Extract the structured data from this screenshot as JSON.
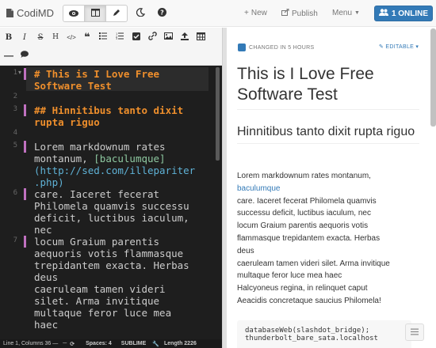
{
  "navbar": {
    "brand": "CodiMD",
    "new_label": "New",
    "publish_label": "Publish",
    "menu_label": "Menu",
    "online_label": "1 ONLINE"
  },
  "editor": {
    "line_numbers": [
      "1",
      "2",
      "3",
      "4",
      "5",
      "6",
      "7"
    ],
    "lines": {
      "l1a": "# This is I Love Free",
      "l1b": "Software Test",
      "l3a": "## Hinnitibus tanto dixit",
      "l3b": "rupta riguo",
      "l5a": "Lorem markdownum rates",
      "l5b_pre": "montanum, ",
      "l5b_link": "[baculumque]",
      "l5c": "(http://sed.com/illepariter",
      "l5d": ".php)",
      "l6a": "care. Iaceret fecerat",
      "l6b": "Philomela quamvis successu",
      "l6c": "deficit, luctibus iaculum,",
      "l6d": "nec",
      "l7a": "locum Graium parentis",
      "l7b": "aequoris votis flammasque",
      "l7c": "trepidantem exacta. Herbas",
      "l7d": "deus",
      "l8a": "caeruleam tamen videri",
      "l8b": "silet. Arma invitique",
      "l8c": "multaque feror luce mea",
      "l8d": "haec"
    }
  },
  "status": {
    "position": "Line 1, Columns 36 —",
    "spaces": "Spaces: 4",
    "keymap": "SUBLIME",
    "length": "Length 2226"
  },
  "preview": {
    "changed": "CHANGED IN 5 HOURS",
    "editable": "EDITABLE",
    "h1": "This is I Love Free Software Test",
    "h2": "Hinnitibus tanto dixit rupta riguo",
    "para_pre": "Lorem markdownum rates montanum,",
    "para_link": "baculumque",
    "para_l1": "care. Iaceret fecerat Philomela quamvis",
    "para_l2": "successu deficit, luctibus iaculum, nec",
    "para_l3": "locum Graium parentis aequoris votis",
    "para_l4": "flammasque trepidantem exacta. Herbas",
    "para_l5": "deus",
    "para_l6": "caeruleam tamen videri silet. Arma invitique",
    "para_l7": "multaque feror luce mea haec",
    "para_l8": "Halcyoneus regina, in relinquet caput",
    "para_l9": "Aeacidis concretaque saucius Philomela!",
    "code_l1": "databaseWeb(slashdot_bridge);",
    "code_l2": "thunderbolt_bare_sata.localhost"
  },
  "colors": {
    "accent": "#337ab7",
    "heading_md": "#ef8f2c",
    "editor_bg": "#1e1e1e"
  }
}
